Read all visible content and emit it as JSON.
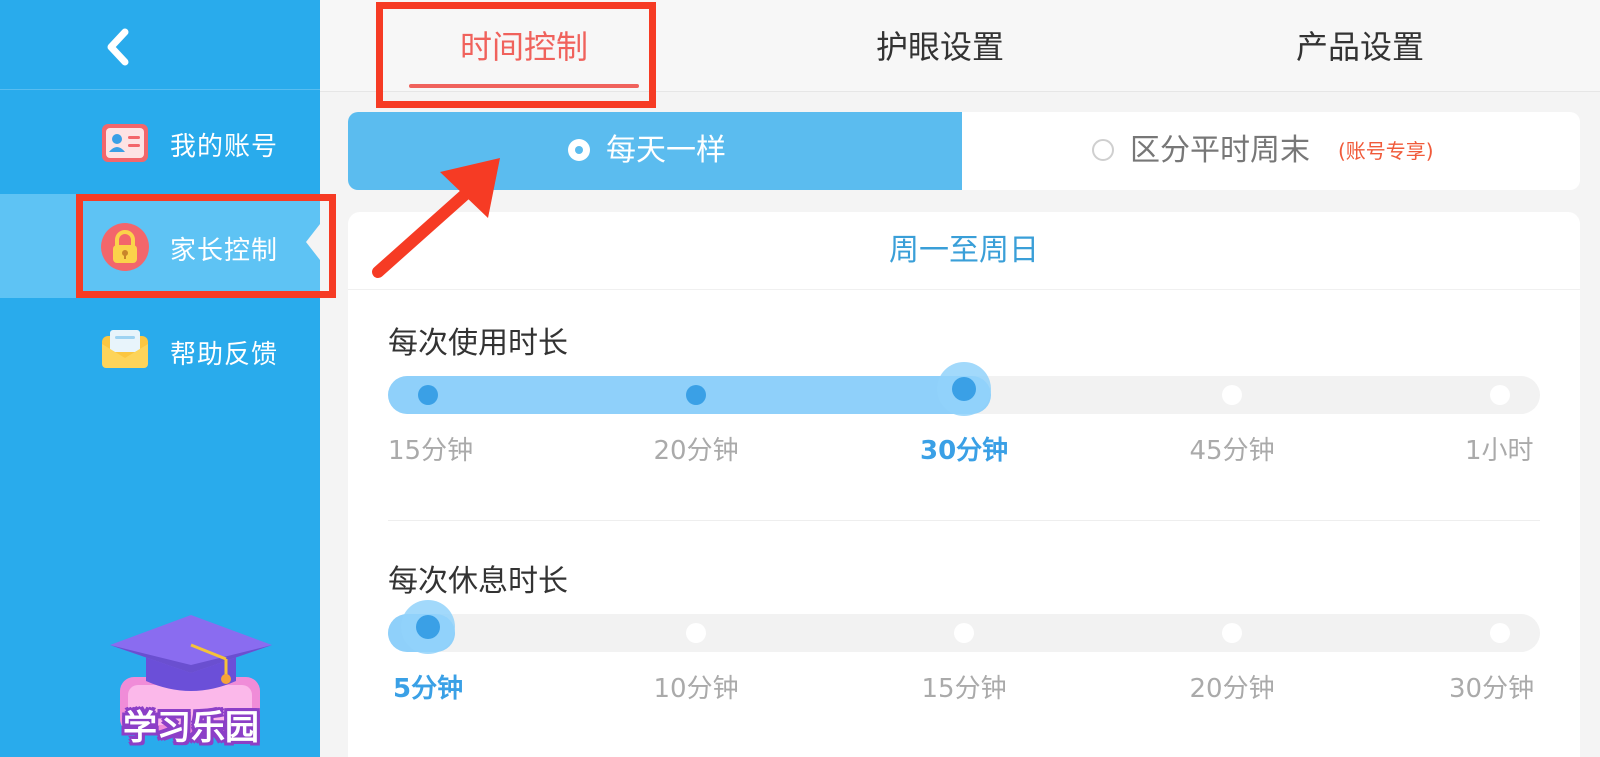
{
  "sidebar": {
    "items": [
      {
        "label": "我的账号",
        "icon": "id-card-icon",
        "active": false
      },
      {
        "label": "家长控制",
        "icon": "lock-icon",
        "active": true
      },
      {
        "label": "帮助反馈",
        "icon": "envelope-icon",
        "active": false
      }
    ],
    "promo_label": "学习乐园"
  },
  "tabs": [
    {
      "label": "时间控制",
      "active": true
    },
    {
      "label": "护眼设置",
      "active": false
    },
    {
      "label": "产品设置",
      "active": false
    }
  ],
  "mode_selector": {
    "options": [
      {
        "label": "每天一样",
        "selected": true
      },
      {
        "label": "区分平时周末",
        "badge": "(账号专享)",
        "selected": false
      }
    ]
  },
  "schedule": {
    "header": "周一至周日",
    "usage": {
      "title": "每次使用时长",
      "options": [
        "15分钟",
        "20分钟",
        "30分钟",
        "45分钟",
        "1小时"
      ],
      "selected_index": 2
    },
    "rest": {
      "title": "每次休息时长",
      "options": [
        "5分钟",
        "10分钟",
        "15分钟",
        "20分钟",
        "30分钟"
      ],
      "selected_index": 0
    }
  },
  "colors": {
    "sidebar_bg": "#29abec",
    "accent_blue": "#5bbcef",
    "active_tab": "#f0625c",
    "annotation_red": "#f63b24"
  }
}
